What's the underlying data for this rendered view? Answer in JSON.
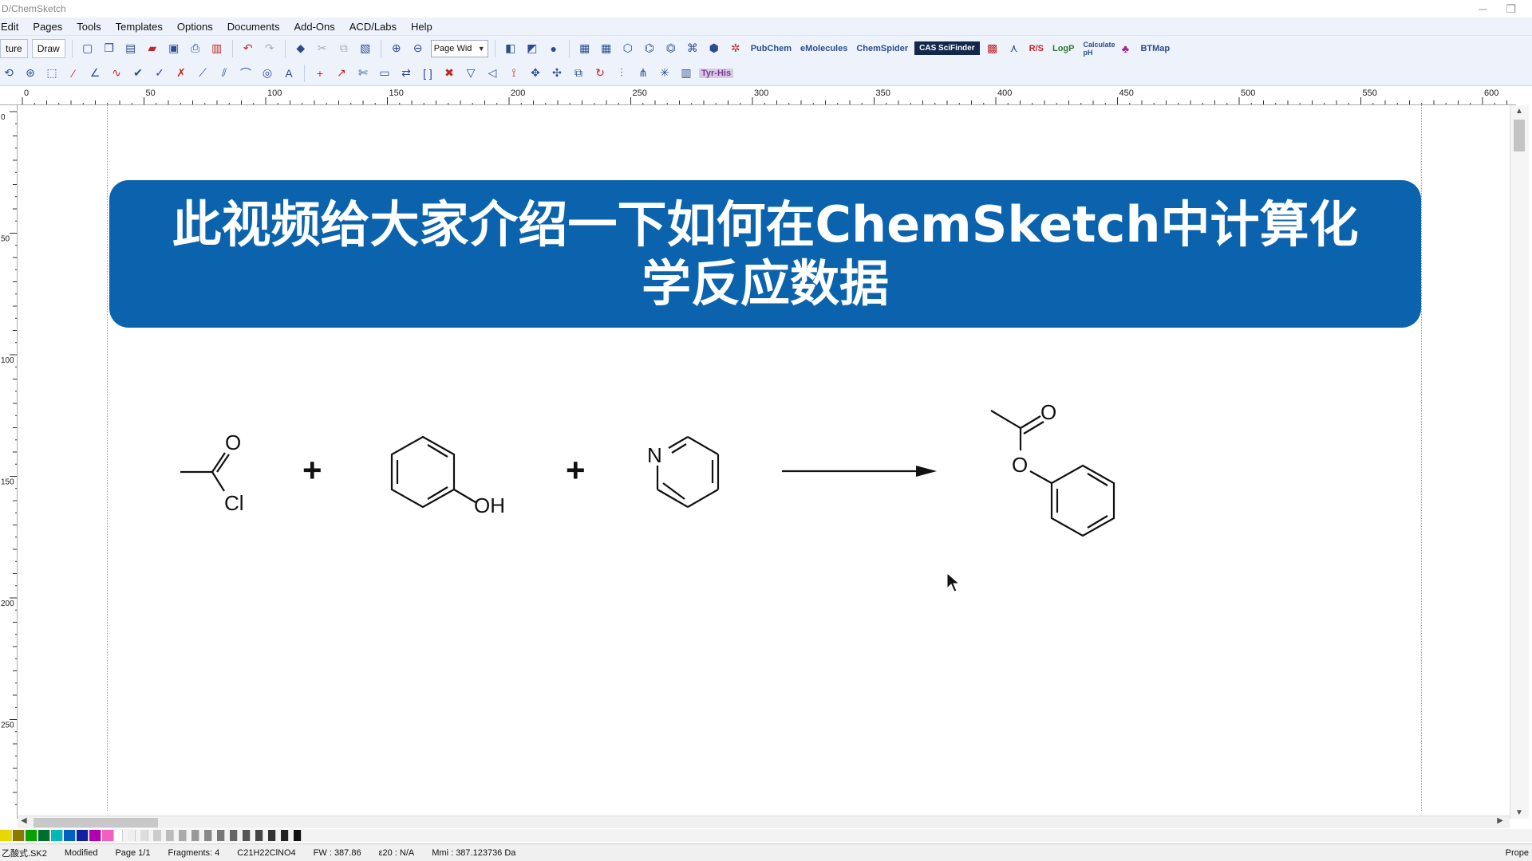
{
  "window": {
    "title": "D/ChemSketch",
    "min_glyph": "─",
    "max_glyph": "❐"
  },
  "menu": [
    "Edit",
    "Pages",
    "Tools",
    "Templates",
    "Options",
    "Documents",
    "Add-Ons",
    "ACD/Labs",
    "Help"
  ],
  "toolbar": {
    "structure_tab": "ture",
    "draw_tab": "Draw",
    "zoom_combo": "Page Wid",
    "pubchem": "PubChem",
    "emolecules": "eMolecules",
    "chemspider": "ChemSpider",
    "cas": "CAS SciFinder",
    "rs": "R/S",
    "logp": "LogP",
    "calc_ph": "Calculate pH",
    "btmap": "BTMap",
    "nmr": "Tyr-His"
  },
  "ruler": {
    "unit": "pt",
    "h_labels": [
      "0",
      "50",
      "100",
      "150",
      "200",
      "250",
      "300",
      "350",
      "400",
      "450",
      "500",
      "550",
      "600"
    ],
    "v_labels": [
      "0",
      "50",
      "100",
      "150",
      "200",
      "250"
    ]
  },
  "banner": {
    "line1": "此视频给大家介绍一下如何在ChemSketch中计算化",
    "line2": "学反应数据",
    "color": "#0b63ad"
  },
  "reaction": {
    "plus": "+",
    "acetyl_chloride": {
      "o": "O",
      "cl": "Cl"
    },
    "phenol": {
      "oh": "OH"
    },
    "pyridine": {
      "n": "N"
    },
    "product": {
      "o_carbonyl": "O",
      "o_ester": "O"
    }
  },
  "status": {
    "file": "乙酸式.SK2",
    "modified": "Modified",
    "page": "Page 1/1",
    "fragments": "Fragments: 4",
    "formula": "C21H22ClNO4",
    "fw": "FW : 387.86",
    "e20": "ε20 : N/A",
    "mass": "Mmi : 387.123736 Da",
    "props": "Prope"
  },
  "palette_colors": [
    "#e6d800",
    "#8a7a00",
    "#0aa000",
    "#006f2e",
    "#00b8b8",
    "#0060c0",
    "#1020a0",
    "#b000b0",
    "#f060c0",
    "#ffffff",
    "#eeeeee",
    "#dddddd",
    "#cccccc",
    "#bbbbbb",
    "#aaaaaa",
    "#999999",
    "#888888",
    "#777777",
    "#666666",
    "#555555",
    "#444444",
    "#333333",
    "#222222",
    "#111111"
  ]
}
